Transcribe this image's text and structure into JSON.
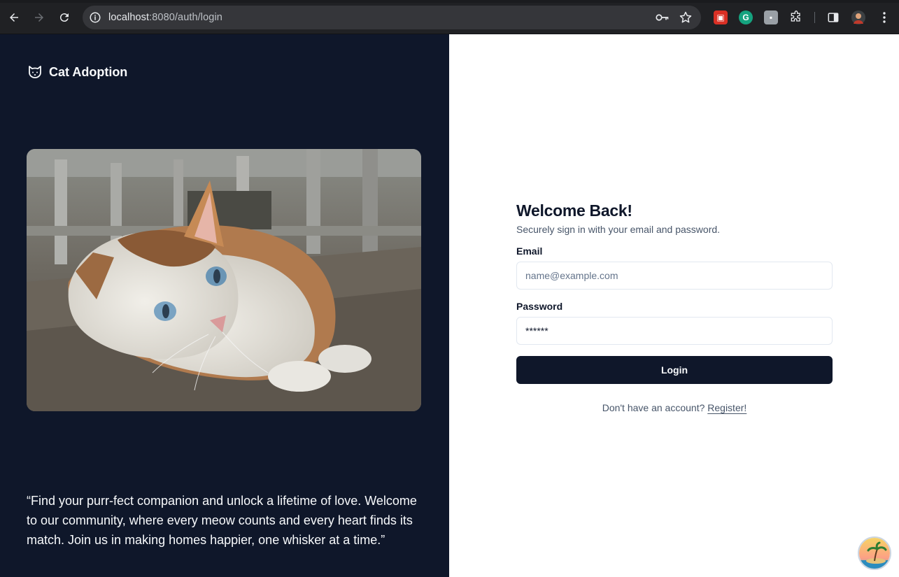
{
  "browser": {
    "url_host": "localhost",
    "url_rest": ":8080/auth/login",
    "extensions": [
      "ext-red-icon",
      "grammarly-icon",
      "ext-gray-icon",
      "puzzle-icon"
    ],
    "accent": "#202124"
  },
  "brand": {
    "name": "Cat Adoption",
    "icon": "cat-icon"
  },
  "hero": {
    "quote": "“Find your purr-fect companion and unlock a lifetime of love. Welcome to our community, where every meow counts and every heart finds its match. Join us in making homes happier, one whisker at a time.”"
  },
  "login": {
    "title": "Welcome Back!",
    "subtitle": "Securely sign in with your email and password.",
    "email_label": "Email",
    "email_placeholder": "name@example.com",
    "password_label": "Password",
    "password_value": "******",
    "submit_label": "Login",
    "register_prompt": "Don't have an account?",
    "register_link": "Register!"
  },
  "colors": {
    "panel_dark": "#0f172a",
    "text_muted": "#475569",
    "border": "#e2e8f0"
  }
}
